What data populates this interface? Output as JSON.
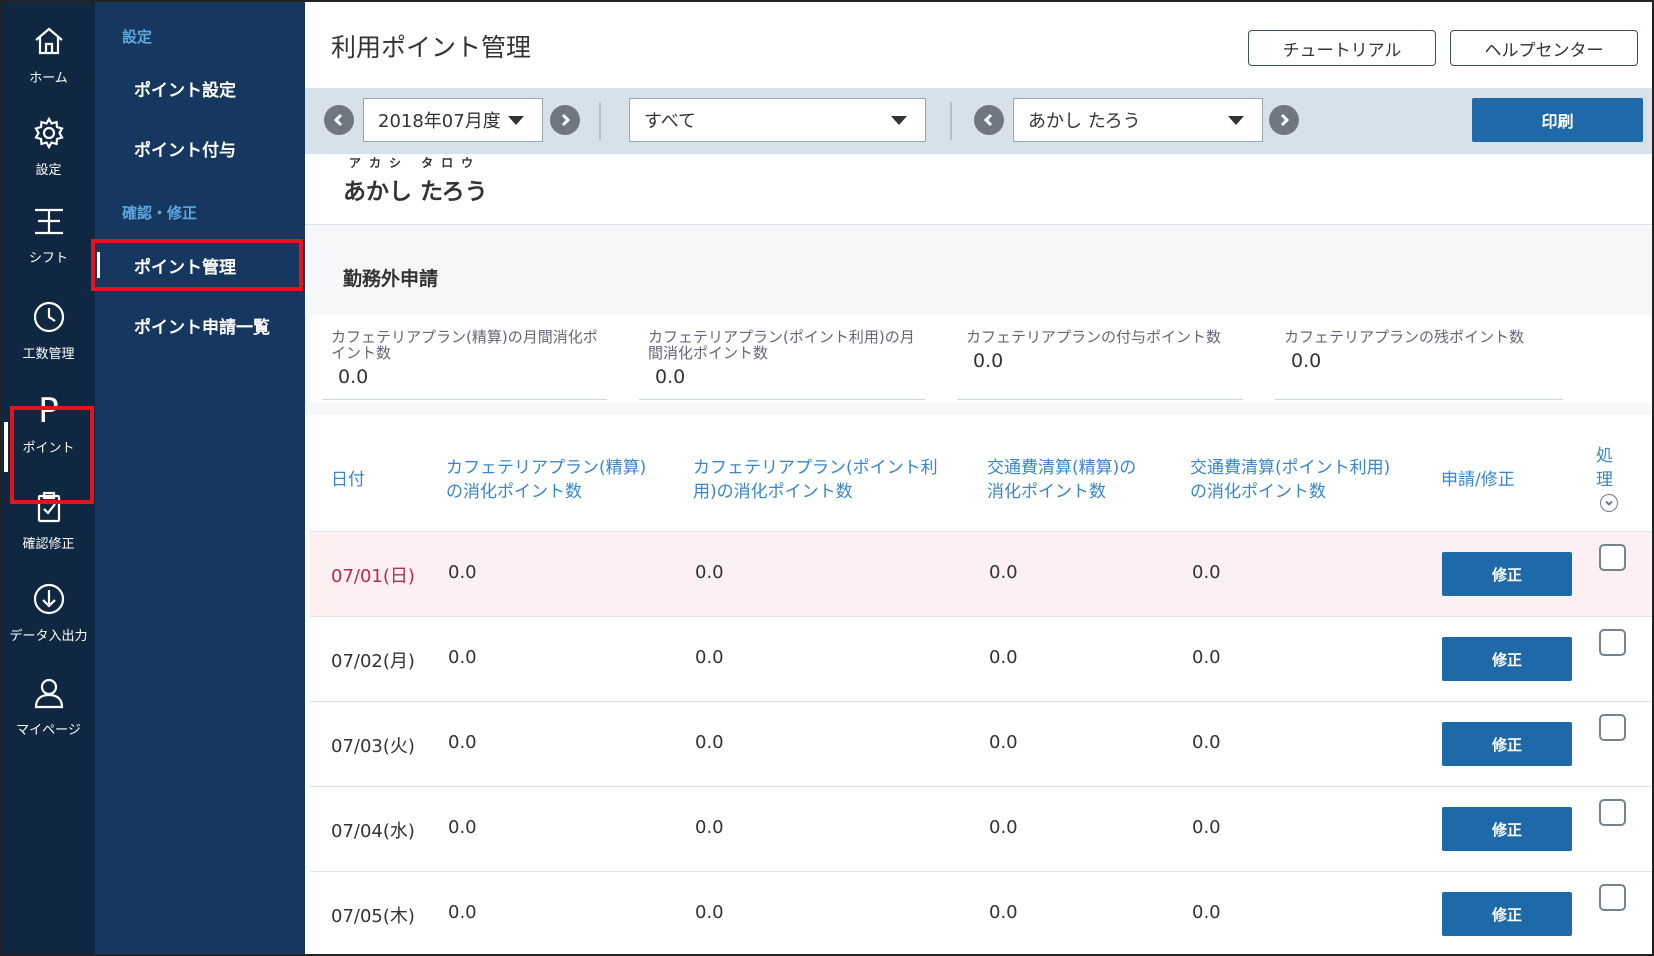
{
  "rail": {
    "items": [
      {
        "label": "ホーム",
        "icon": "home-icon"
      },
      {
        "label": "設定",
        "icon": "gear-icon"
      },
      {
        "label": "シフト",
        "icon": "shift-icon"
      },
      {
        "label": "工数管理",
        "icon": "clock-icon"
      },
      {
        "label": "ポイント",
        "icon": "point-icon",
        "glyph": "P"
      },
      {
        "label": "確認修正",
        "icon": "clipboard-check-icon"
      },
      {
        "label": "データ入出力",
        "icon": "download-icon"
      },
      {
        "label": "マイページ",
        "icon": "user-icon"
      }
    ],
    "active_index": 4
  },
  "subnav": {
    "heading_settings": "設定",
    "item_point_settings": "ポイント設定",
    "item_point_grant": "ポイント付与",
    "heading_confirm": "確認・修正",
    "item_point_management": "ポイント管理",
    "item_point_requests": "ポイント申請一覧"
  },
  "header": {
    "title": "利用ポイント管理",
    "tutorial_button": "チュートリアル",
    "help_button": "ヘルプセンター"
  },
  "toolbar": {
    "month_select": "2018年07月度",
    "filter_select": "すべて",
    "person_select": "あかし たろう",
    "print_button": "印刷"
  },
  "person": {
    "kana": "アカシ タロウ",
    "name": "あかし たろう"
  },
  "section": {
    "title": "勤務外申請",
    "summary": [
      {
        "label_line1": "カフェテリアプラン(精算)の月間消化ポ",
        "label_line2": "イント数",
        "value": "0.0"
      },
      {
        "label_line1": "カフェテリアプラン(ポイント利用)の月",
        "label_line2": "間消化ポイント数",
        "value": "0.0"
      },
      {
        "label_line1": "カフェテリアプランの付与ポイント数",
        "label_line2": "",
        "value": "0.0"
      },
      {
        "label_line1": "カフェテリアプランの残ポイント数",
        "label_line2": "",
        "value": "0.0"
      }
    ]
  },
  "table": {
    "headers": {
      "date": "日付",
      "col1_line1": "カフェテリアプラン(精算)",
      "col1_line2": "の消化ポイント数",
      "col2_line1": "カフェテリアプラン(ポイント利",
      "col2_line2": "用)の消化ポイント数",
      "col3_line1": "交通費清算(精算)の",
      "col3_line2": "消化ポイント数",
      "col4_line1": "交通費清算(ポイント利用)",
      "col4_line2": "の消化ポイント数",
      "apply": "申請/修正",
      "process_line1": "処",
      "process_line2": "理"
    },
    "fix_label": "修正",
    "rows": [
      {
        "date": "07/01(日)",
        "c1": "0.0",
        "c2": "0.0",
        "c3": "0.0",
        "c4": "0.0"
      },
      {
        "date": "07/02(月)",
        "c1": "0.0",
        "c2": "0.0",
        "c3": "0.0",
        "c4": "0.0"
      },
      {
        "date": "07/03(火)",
        "c1": "0.0",
        "c2": "0.0",
        "c3": "0.0",
        "c4": "0.0"
      },
      {
        "date": "07/04(水)",
        "c1": "0.0",
        "c2": "0.0",
        "c3": "0.0",
        "c4": "0.0"
      },
      {
        "date": "07/05(木)",
        "c1": "0.0",
        "c2": "0.0",
        "c3": "0.0",
        "c4": "0.0"
      }
    ]
  },
  "colors": {
    "rail_bg": "#0f2740",
    "subnav_bg": "#153760",
    "accent_blue": "#1e6aa8",
    "header_text_blue": "#3a86c8",
    "sunday_red": "#c22552",
    "highlight_red": "#e0161c"
  }
}
